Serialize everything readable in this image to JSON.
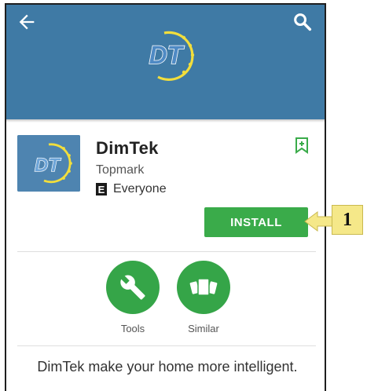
{
  "header": {
    "logo_text": "DT",
    "colors": {
      "background": "#3f7aa5",
      "logo_text": "#4f8ac4",
      "logo_ring": "#f2de3c"
    }
  },
  "app": {
    "name": "DimTek",
    "developer": "Topmark",
    "content_rating_letter": "E",
    "content_rating": "Everyone",
    "install_label": "INSTALL",
    "colors": {
      "install": "#3aab4a",
      "icon_background": "#4e84b0"
    }
  },
  "actions": [
    {
      "label": "Tools",
      "icon": "wrench-icon"
    },
    {
      "label": "Similar",
      "icon": "cards-icon"
    }
  ],
  "description": "DimTek make your home more intelligent.",
  "callout": {
    "label": "1",
    "color": "#f5e889"
  }
}
